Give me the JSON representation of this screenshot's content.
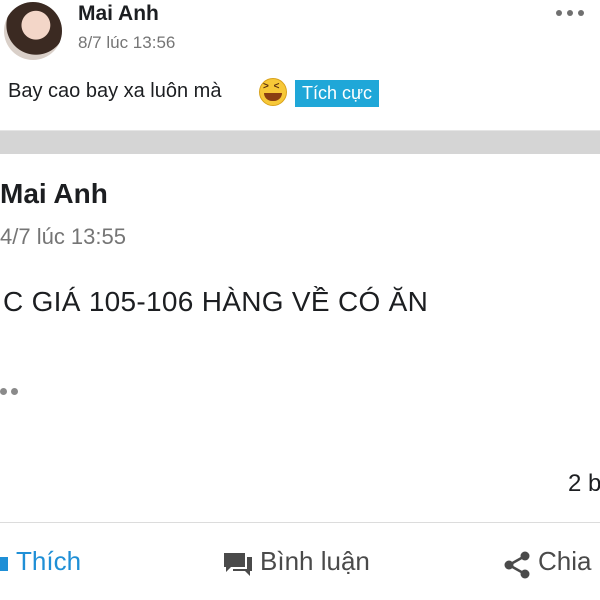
{
  "post": {
    "author": "Mai Anh",
    "time": "8/7 lúc 13:56",
    "text": "Bay cao bay xa luôn mà",
    "emoji": "laughing-face",
    "tag": "Tích cực"
  },
  "shared_post": {
    "author": "Mai Anh",
    "time": "4/7 lúc 13:55",
    "text": "C GIÁ 105-106 HÀNG VỀ CÓ ĂN",
    "count": "2 b"
  },
  "actions": {
    "like": "Thích",
    "comment": "Bình luận",
    "share": "Chia"
  },
  "colors": {
    "accent": "#1f8fd6",
    "tag_bg": "#1fa7d8",
    "divider_band": "#d5d5d5"
  }
}
